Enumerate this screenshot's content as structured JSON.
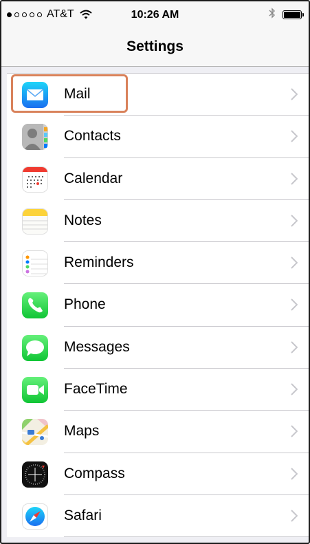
{
  "status": {
    "carrier": "AT&T",
    "time": "10:26 AM",
    "signal_bars": 1
  },
  "nav": {
    "title": "Settings"
  },
  "items": [
    {
      "label": "Mail",
      "icon": "mail-icon"
    },
    {
      "label": "Contacts",
      "icon": "contacts-icon"
    },
    {
      "label": "Calendar",
      "icon": "calendar-icon"
    },
    {
      "label": "Notes",
      "icon": "notes-icon"
    },
    {
      "label": "Reminders",
      "icon": "reminders-icon"
    },
    {
      "label": "Phone",
      "icon": "phone-icon"
    },
    {
      "label": "Messages",
      "icon": "messages-icon"
    },
    {
      "label": "FaceTime",
      "icon": "facetime-icon"
    },
    {
      "label": "Maps",
      "icon": "maps-icon"
    },
    {
      "label": "Compass",
      "icon": "compass-icon"
    },
    {
      "label": "Safari",
      "icon": "safari-icon"
    }
  ],
  "highlight": {
    "target": "Mail",
    "color": "#d9825b"
  }
}
